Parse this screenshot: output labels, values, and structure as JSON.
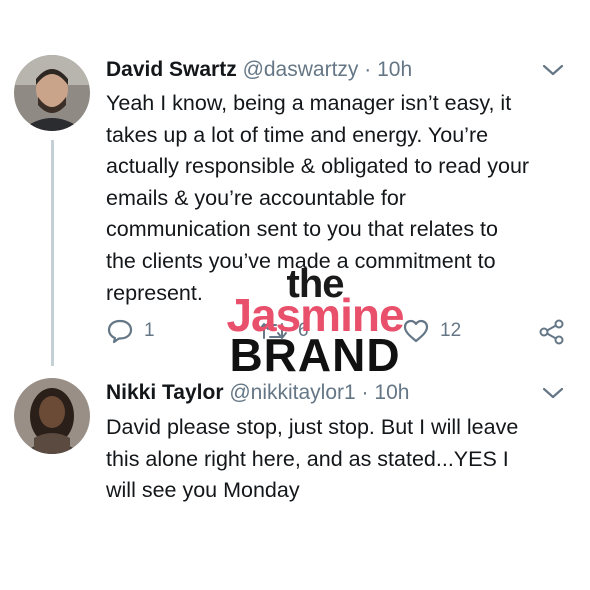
{
  "tweets": [
    {
      "name": "David Swartz",
      "handle": "@daswartzy",
      "separator": "·",
      "time": "10h",
      "lines": [
        "Yeah I know, being a manager isn’t easy, it",
        "takes up a lot of time and energy. You’re",
        "actually responsible & obligated to read your",
        "emails & you’re accountable for",
        "communication sent to you that relates to",
        "the clients you’ve made a commitment to",
        "represent."
      ],
      "reply_count": "1",
      "retweet_count": "6",
      "like_count": "12"
    },
    {
      "name": "Nikki Taylor",
      "handle": "@nikkitaylor1",
      "separator": "·",
      "time": "10h",
      "lines": [
        "David please stop, just stop. But I will leave",
        "this alone right here, and as stated...YES I",
        "will see you Monday"
      ]
    }
  ],
  "watermark": {
    "line1": "the",
    "line2": "Jasmine",
    "line3": "BRAND"
  },
  "colors": {
    "text": "#14171a",
    "muted": "#657786",
    "thread_line": "#c4cfd6",
    "watermark_pink": "#e8506b"
  }
}
